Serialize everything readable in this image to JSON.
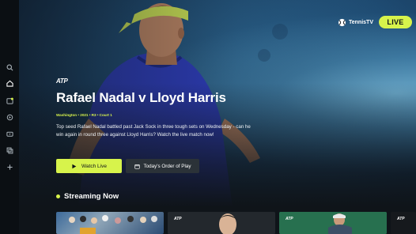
{
  "nav": {
    "items": [
      {
        "name": "search",
        "icon": "search-icon"
      },
      {
        "name": "home",
        "icon": "home-icon",
        "active": true
      },
      {
        "name": "schedule",
        "icon": "calendar-icon"
      },
      {
        "name": "replays",
        "icon": "replay-icon"
      },
      {
        "name": "live",
        "icon": "live-tv-icon"
      },
      {
        "name": "library",
        "icon": "library-icon"
      },
      {
        "name": "more",
        "icon": "plus-icon"
      }
    ]
  },
  "header": {
    "brand_label": "TennisTV",
    "live_label": "LIVE"
  },
  "hero": {
    "badge": "ATP",
    "title": "Rafael Nadal v Lloyd Harris",
    "meta": "Washington • 2021 • R3 • Court 1",
    "description": "Top seed Rafael Nadal battled past Jack Sock in three tough sets on Wednesday - can he win again in round three against Lloyd Harris? Watch the live match now!",
    "watch_button": "Watch Live",
    "order_button": "Today's Order of Play"
  },
  "streaming": {
    "title": "Streaming Now",
    "items": [
      {
        "badge": ""
      },
      {
        "badge": "ATP"
      },
      {
        "badge": "ATP"
      },
      {
        "badge": "ATP"
      }
    ]
  },
  "colors": {
    "accent": "#d7f34b",
    "background": "#0f1419",
    "button_secondary": "#2b3238"
  }
}
